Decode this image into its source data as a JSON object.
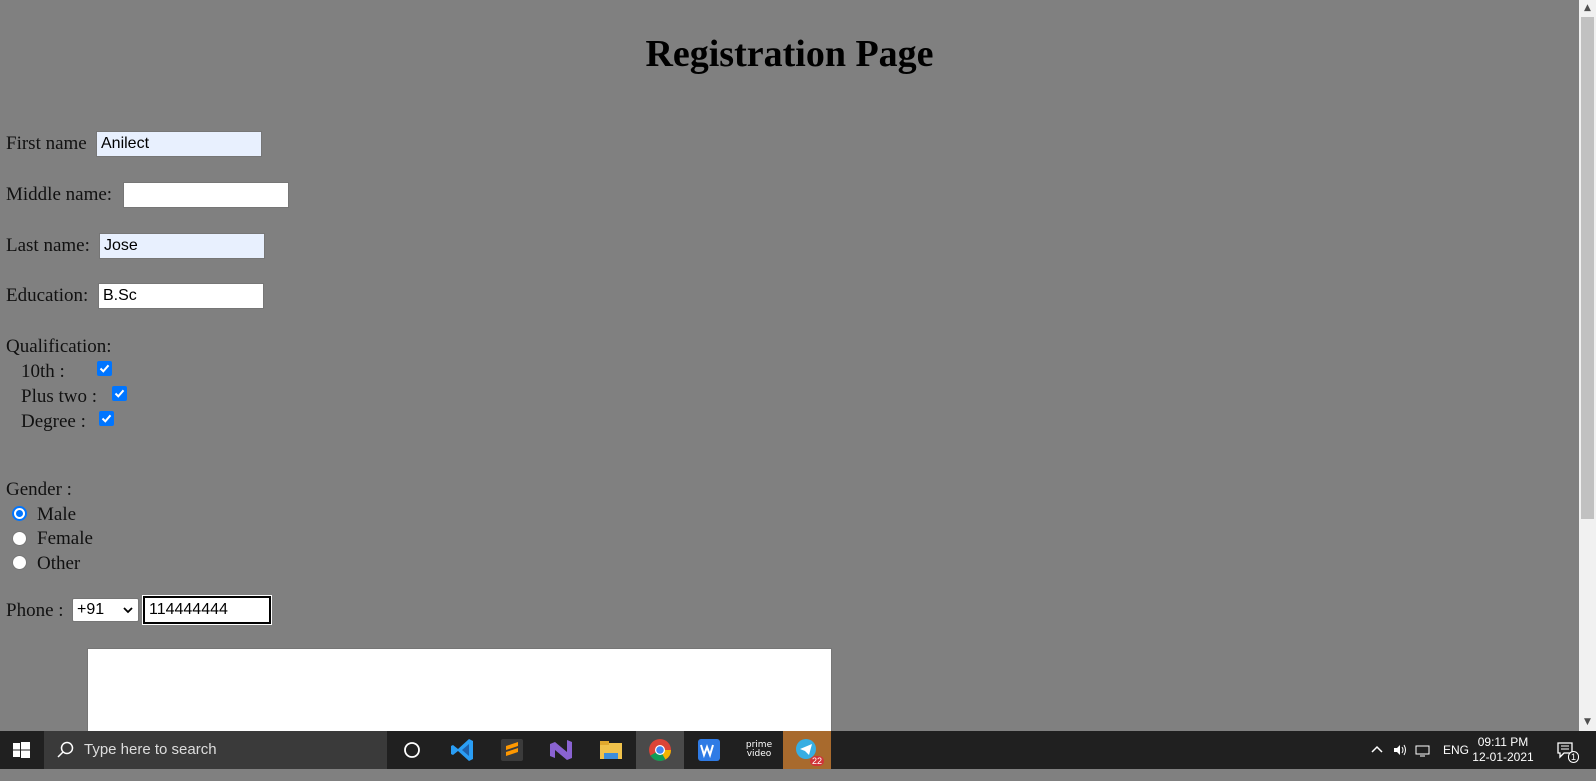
{
  "title": "Registration Page",
  "form": {
    "first_name_label": "First name",
    "first_name_value": "Anilect",
    "middle_name_label": "Middle name:",
    "middle_name_value": "",
    "last_name_label": "Last name:",
    "last_name_value": "Jose",
    "education_label": "Education:",
    "education_value": "B.Sc",
    "qualification_label": "Qualification:",
    "qualifications": [
      {
        "label": "10th :",
        "checked": true
      },
      {
        "label": "Plus two :",
        "checked": true
      },
      {
        "label": "Degree :",
        "checked": true
      }
    ],
    "gender_label": "Gender :",
    "genders": [
      {
        "label": "Male",
        "selected": true
      },
      {
        "label": "Female",
        "selected": false
      },
      {
        "label": "Other",
        "selected": false
      }
    ],
    "phone_label": "Phone :",
    "phone_code": "+91",
    "phone_value": "114444444"
  },
  "taskbar": {
    "search_placeholder": "Type here to search",
    "apps": [
      "cortana-icon",
      "vscode-icon",
      "sublime-icon",
      "visual-studio-icon",
      "file-explorer-icon",
      "chrome-icon",
      "wps-icon",
      "prime-video-icon",
      "telegram-icon"
    ],
    "prime_label": "prime video",
    "telegram_badge": "22",
    "language": "ENG",
    "time": "09:11 PM",
    "date": "12-01-2021",
    "notification_count": "1"
  },
  "colors": {
    "background": "#808080",
    "autofill": "#e8f0fe",
    "accent": "#0075ff",
    "taskbar": "#202020"
  }
}
